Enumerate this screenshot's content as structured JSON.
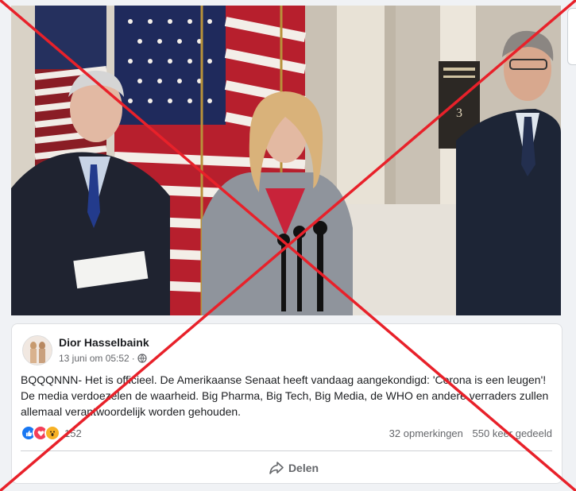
{
  "post": {
    "author": "Dior Hasselbaink",
    "timestamp": "13 juni om 05:52",
    "audience_icon": "globe-icon",
    "text": "BQQQNNN- Het is officieel. De Amerikaanse Senaat heeft vandaag aangekondigd: 'Corona is een leugen'! De media verdoezelen de waarheid. Big Pharma, Big Tech, Big Media, de WHO en andere verraders zullen allemaal verantwoordelijk worden gehouden.",
    "reaction_count": "152",
    "comments": "32 opmerkingen",
    "shares": "550 keer gedeeld",
    "share_label": "Delen"
  },
  "colors": {
    "cross_red": "#e8212a",
    "like_blue": "#1877f2",
    "love_red": "#f33e58",
    "wow_yellow": "#f7b125"
  }
}
